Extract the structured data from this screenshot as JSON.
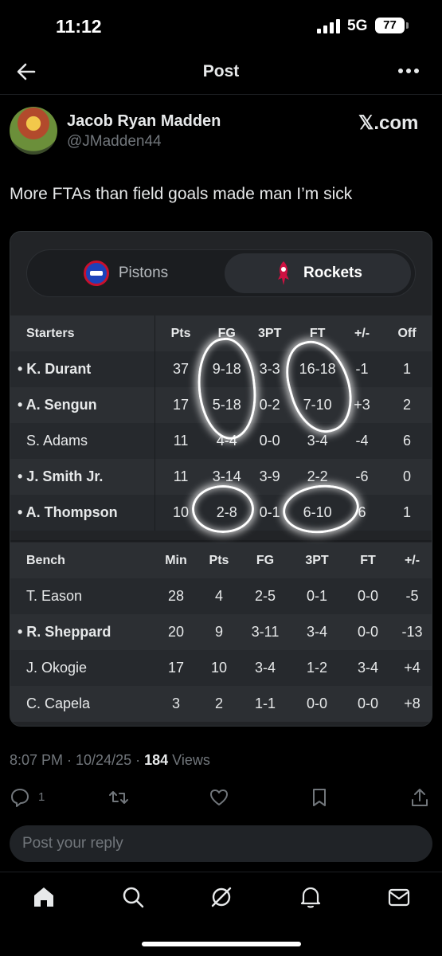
{
  "status": {
    "time": "11:12",
    "network": "5G",
    "battery": "77"
  },
  "header": {
    "title": "Post"
  },
  "author": {
    "name": "Jacob Ryan Madden",
    "handle": "@JMadden44",
    "source": "𝕏.com"
  },
  "post": {
    "text": "More FTAs than field goals made man I’m sick"
  },
  "game": {
    "teams": {
      "home": "Pistons",
      "away": "Rockets"
    },
    "starters_headers": [
      "Starters",
      "Pts",
      "FG",
      "3PT",
      "FT",
      "+/-",
      "Off"
    ],
    "starters": [
      {
        "name": "• K. Durant",
        "pts": "37",
        "fg": "9-18",
        "tp": "3-3",
        "ft": "16-18",
        "pm": "-1",
        "off": "1"
      },
      {
        "name": "• A. Sengun",
        "pts": "17",
        "fg": "5-18",
        "tp": "0-2",
        "ft": "7-10",
        "pm": "+3",
        "off": "2"
      },
      {
        "name": "S. Adams",
        "pts": "11",
        "fg": "4-4",
        "tp": "0-0",
        "ft": "3-4",
        "pm": "-4",
        "off": "6"
      },
      {
        "name": "• J. Smith Jr.",
        "pts": "11",
        "fg": "3-14",
        "tp": "3-9",
        "ft": "2-2",
        "pm": "-6",
        "off": "0"
      },
      {
        "name": "• A. Thompson",
        "pts": "10",
        "fg": "2-8",
        "tp": "0-1",
        "ft": "6-10",
        "pm": "6",
        "off": "1"
      }
    ],
    "bench_headers": [
      "Bench",
      "Min",
      "Pts",
      "FG",
      "3PT",
      "FT",
      "+/-"
    ],
    "bench": [
      {
        "name": "T. Eason",
        "min": "28",
        "pts": "4",
        "fg": "2-5",
        "tp": "0-1",
        "ft": "0-0",
        "pm": "-5"
      },
      {
        "name": "• R. Sheppard",
        "min": "20",
        "pts": "9",
        "fg": "3-11",
        "tp": "3-4",
        "ft": "0-0",
        "pm": "-13"
      },
      {
        "name": "J. Okogie",
        "min": "17",
        "pts": "10",
        "fg": "3-4",
        "tp": "1-2",
        "ft": "3-4",
        "pm": "+4"
      },
      {
        "name": "C. Capela",
        "min": "3",
        "pts": "2",
        "fg": "1-1",
        "tp": "0-0",
        "ft": "0-0",
        "pm": "+8"
      }
    ]
  },
  "meta": {
    "time": "8:07 PM · 10/24/25 · ",
    "views_count": "184",
    "views_label": " Views"
  },
  "actions": {
    "reply_count": "1"
  },
  "reply": {
    "placeholder": "Post your reply"
  },
  "icons": {
    "back": "arrow-left-icon",
    "more": "more-dots-icon",
    "reply": "reply-icon",
    "repost": "repost-icon",
    "like": "heart-icon",
    "bookmark": "bookmark-icon",
    "share": "share-icon",
    "home": "home-icon",
    "search": "search-icon",
    "grok": "grok-icon",
    "notifications": "bell-icon",
    "messages": "mail-icon"
  }
}
